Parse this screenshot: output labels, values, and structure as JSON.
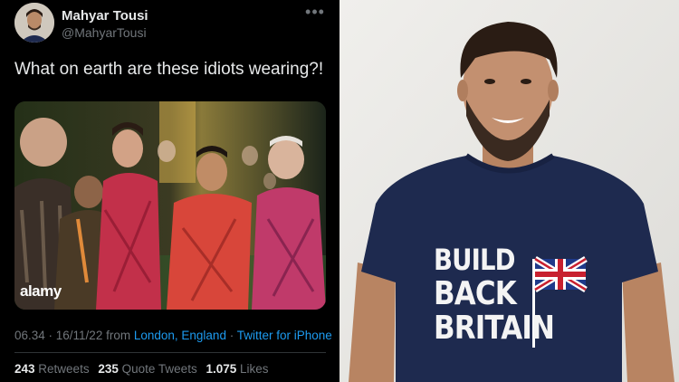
{
  "tweet": {
    "display_name": "Mahyar Tousi",
    "handle": "@MahyarTousi",
    "more_icon": "more-horizontal-icon",
    "text": "What on earth are these idiots wearing?!",
    "media": {
      "watermark": "alamy"
    },
    "meta": {
      "time_date": "06.34 · 16/11/22 from",
      "location": "London, England",
      "separator": "·",
      "client": "Twitter for iPhone"
    },
    "stats": {
      "retweets_count": "243",
      "retweets_label": "Retweets",
      "quotes_count": "235",
      "quotes_label": "Quote Tweets",
      "likes_count": "1.075",
      "likes_label": "Likes"
    },
    "colors": {
      "background": "#000000",
      "text": "#e7e9ea",
      "secondary": "#71767b",
      "link": "#1d9bf0"
    }
  },
  "photo": {
    "shirt": {
      "line1": "BUILD",
      "line2": "BACK",
      "line3": "BRITAIN"
    },
    "colors": {
      "shirt": "#1e2a4f",
      "wall": "#ecebe8"
    }
  }
}
